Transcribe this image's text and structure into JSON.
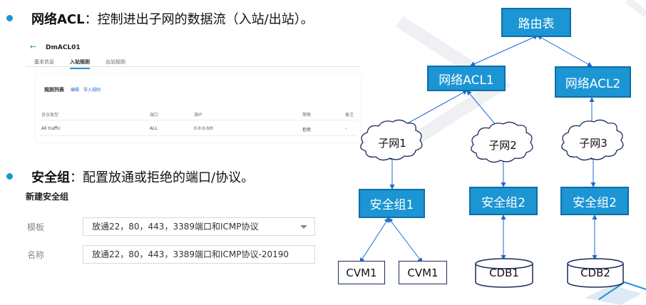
{
  "top_bullet": {
    "bold": "网络ACL",
    "text": "：控制进出子网的数据流（入站/出站）。"
  },
  "acl_panel": {
    "title": "DmACL01",
    "tabs": [
      "基本信息",
      "入站规则",
      "出站规则"
    ],
    "rules_label": "规则列表",
    "links": [
      "编辑",
      "导入规则"
    ],
    "columns": [
      "协议类型",
      "端口",
      "源IP",
      "策略",
      "备注"
    ],
    "row": [
      "All traffic",
      "ALL",
      "0.0.0.0/0",
      "拒绝",
      "-"
    ]
  },
  "second_bullet": {
    "bold": "安全组",
    "text": "：配置放通或拒绝的端口/协议。"
  },
  "sg_form": {
    "title": "新建安全组",
    "template_label": "模板",
    "template_value": "放通22，80，443，3389端口和ICMP协议",
    "name_label": "名称",
    "name_value": "放通22，80，443，3389端口和ICMP协议-20190"
  },
  "diagram": {
    "route_table": "路由表",
    "acl1": "网络ACL1",
    "acl2": "网络ACL2",
    "subnet1": "子网1",
    "subnet2": "子网2",
    "subnet3": "子网3",
    "sg1": "安全组1",
    "sg2a": "安全组2",
    "sg2b": "安全组2",
    "cvm1a": "CVM1",
    "cvm1b": "CVM1",
    "cdb1": "CDB1",
    "cdb2": "CDB2"
  },
  "colors": {
    "accent": "#1b95d3",
    "node_border": "#0f6ea7",
    "link": "#1b6ad3"
  }
}
